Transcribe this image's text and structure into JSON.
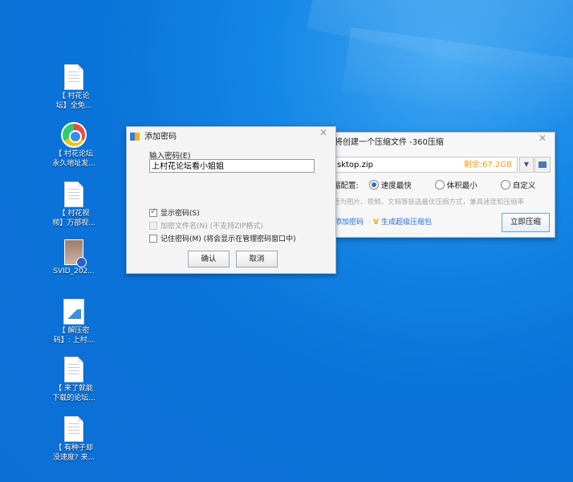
{
  "desktop": {
    "icons": [
      {
        "label1": "【 村花论",
        "label2": "坛】全免..."
      },
      {
        "label1": "【 村花论坛",
        "label2": "永久地址发..."
      },
      {
        "label1": "【 村花视",
        "label2": "频】万部视..."
      },
      {
        "label1": "SVID_202...",
        "label2": ""
      },
      {
        "label1": "【 解压密",
        "label2": "码】: 上村..."
      },
      {
        "label1": "【 来了就能",
        "label2": "下载的论坛..."
      },
      {
        "label1": "【 有种子却",
        "label2": "没速度? 来..."
      }
    ]
  },
  "compress_window": {
    "title": "将创建一个压缩文件 -360压缩",
    "path": "sktop.zip",
    "free_space": "剩余:67.2GB",
    "config_label": "缩配置:",
    "options": [
      "速度最快",
      "体积最小",
      "自定义"
    ],
    "hint": "适为图片、视频、文档等挑选最优压缩方式，兼具速度和压缩率",
    "add_password": "添加密码",
    "super_pack": "生成超级压缩包",
    "compress_button": "立即压缩"
  },
  "password_dialog": {
    "title": "添加密码",
    "input_label": "输入密码(E)",
    "password_value": "上村花论坛看小姐姐",
    "show_password": "显示密码(S)",
    "encrypt_names": "加密文件名(N) (不支持ZIP格式)",
    "remember_password": "记住密码(M) (将会显示在管理密码窗口中)",
    "ok_button": "确认",
    "cancel_button": "取消"
  }
}
